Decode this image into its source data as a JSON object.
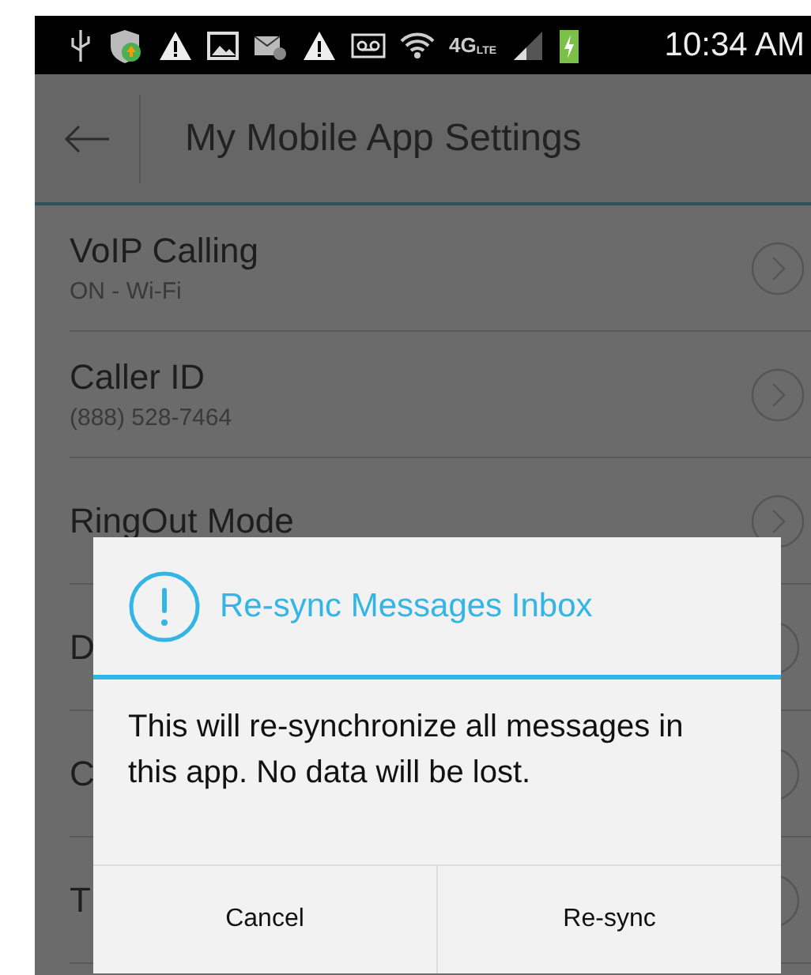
{
  "status_bar": {
    "network": "4G",
    "network_sub": "LTE",
    "time": "10:34 AM"
  },
  "app_bar": {
    "title": "My Mobile App Settings"
  },
  "settings": [
    {
      "title": "VoIP Calling",
      "subtitle": "ON - Wi-Fi"
    },
    {
      "title": "Caller ID",
      "subtitle": "(888) 528-7464"
    },
    {
      "title": "RingOut Mode"
    },
    {
      "title": "D"
    },
    {
      "title": "C"
    },
    {
      "title": "T"
    }
  ],
  "dialog": {
    "title": "Re-sync Messages Inbox",
    "message": "This will re-synchronize all messages in this app. No data will be lost.",
    "buttons": [
      "Cancel",
      "Re-sync"
    ]
  }
}
